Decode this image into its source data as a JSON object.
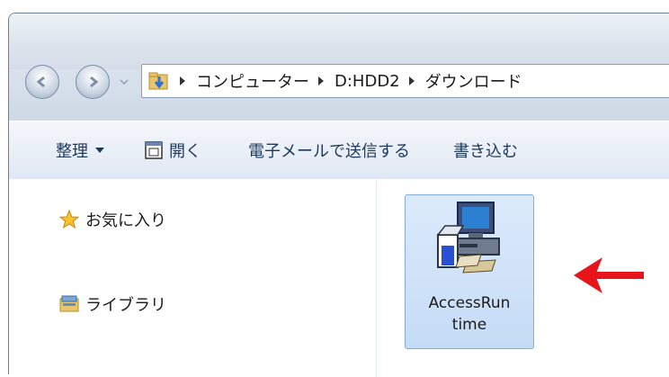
{
  "address_bar": {
    "breadcrumbs": [
      "コンピューター",
      "D:HDD2",
      "ダウンロード"
    ]
  },
  "toolbar": {
    "organize_label": "整理",
    "open_label": "開く",
    "email_label": "電子メールで送信する",
    "burn_label": "書き込む"
  },
  "nav_pane": {
    "favorites_label": "お気に入り",
    "libraries_label": "ライブラリ"
  },
  "files": [
    {
      "name_line1": "AccessRun",
      "name_line2": "time",
      "selected": true,
      "icon": "installer-computer-icon"
    }
  ],
  "annotation": {
    "icon": "red-arrow-icon",
    "color": "#e8141b"
  },
  "colors": {
    "selection_bg": "#cde3f9",
    "selection_border": "#84acdd",
    "toolbar_text": "#1e395b"
  }
}
